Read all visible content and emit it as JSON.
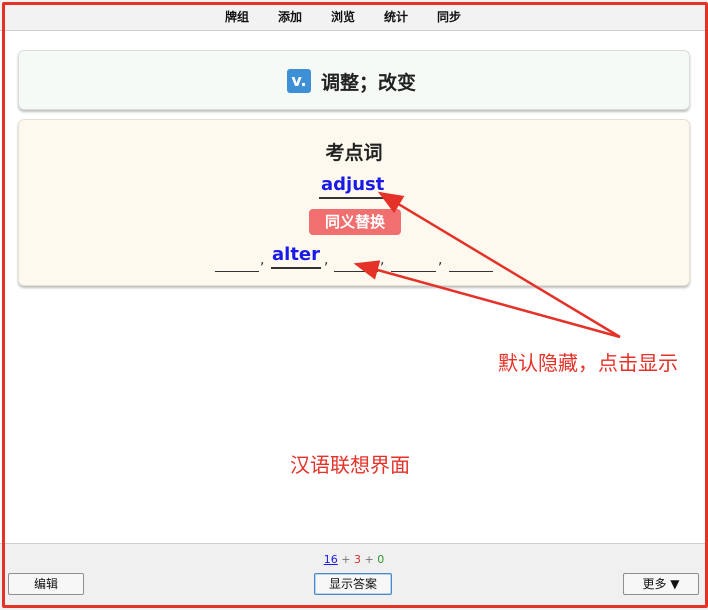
{
  "top_menu": [
    "牌组",
    "添加",
    "浏览",
    "统计",
    "同步"
  ],
  "meaning_card": {
    "pos": "v.",
    "meaning": "调整；改变"
  },
  "association_card": {
    "title": "考点词",
    "keyword": "adjust",
    "synonym_badge": "同义替换",
    "synonyms": [
      "",
      "alter",
      "",
      "",
      ""
    ],
    "separator": ","
  },
  "annotations": {
    "hidden_note": "默认隐藏，点击显示",
    "screen_label": "汉语联想界面",
    "color": "#e53228"
  },
  "bottom_bar": {
    "count_new": "16",
    "count_learn": "3",
    "count_review": "0",
    "plus": "+",
    "edit_label": "编辑",
    "show_answer_label": "显示答案",
    "more_label": "更多 ▼"
  }
}
